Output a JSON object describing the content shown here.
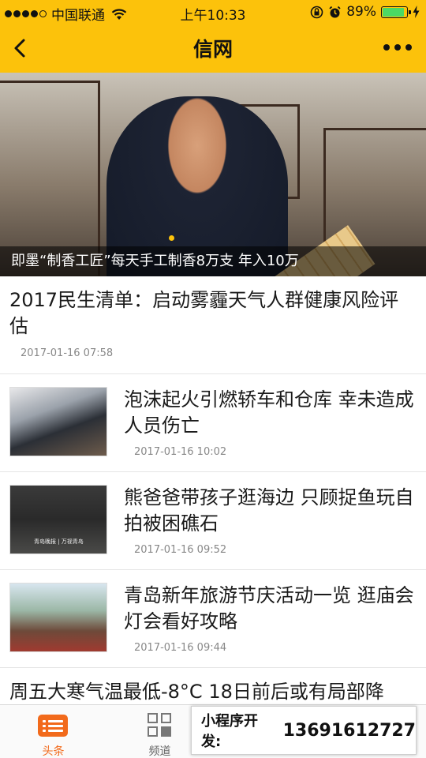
{
  "status_bar": {
    "carrier": "中国联通",
    "time": "上午10:33",
    "battery": "89%",
    "battery_level": 0.89
  },
  "nav": {
    "title": "信网"
  },
  "hero": {
    "caption": "即墨“制香工匠”每天手工制香8万支 年入10万"
  },
  "articles": [
    {
      "title": "2017民生清单：启动雾霾天气人群健康风险评估",
      "date": "2017-01-16 07:58"
    },
    {
      "title": "泡沫起火引燃轿车和仓库 幸未造成人员伤亡",
      "date": "2017-01-16 10:02"
    },
    {
      "title": "熊爸爸带孩子逛海边 只顾捉鱼玩自拍被困礁石",
      "date": "2017-01-16 09:52",
      "thumb_text": "青岛晚报 | 万视青岛"
    },
    {
      "title": "青岛新年旅游节庆活动一览 逛庙会灯会看好攻略",
      "date": "2017-01-16 09:44"
    },
    {
      "title": "周五大寒气温最低-8°C 18日前后或有局部降"
    }
  ],
  "tabs": [
    {
      "label": "头条",
      "icon": "list-icon",
      "active": true
    },
    {
      "label": "频道",
      "icon": "grid-icon",
      "active": false
    },
    {
      "label": "",
      "icon": "",
      "active": false
    },
    {
      "label": "",
      "icon": "",
      "active": false
    }
  ],
  "promo": {
    "label": "小程序开发:",
    "phone": "13691612727"
  },
  "colors": {
    "accent": "#fcc20b",
    "tab_active": "#f26a1b"
  }
}
